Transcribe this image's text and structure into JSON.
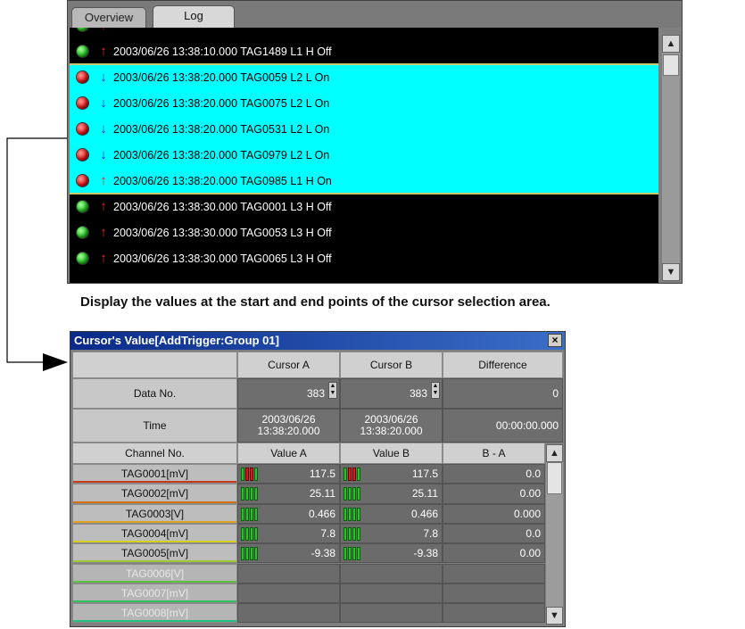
{
  "log_window": {
    "tabs": [
      {
        "label": "Overview",
        "active": false
      },
      {
        "label": "Log",
        "active": true
      }
    ],
    "rows": [
      {
        "status": "green",
        "direction": "up",
        "text": "2003/06/26 13:38:10.000 TAG1489 L1 H  Off",
        "highlighted": false
      },
      {
        "status": "red",
        "direction": "down",
        "text": "2003/06/26 13:38:20.000 TAG0059 L2 L  On",
        "highlighted": true
      },
      {
        "status": "red",
        "direction": "down",
        "text": "2003/06/26 13:38:20.000 TAG0075 L2 L  On",
        "highlighted": true
      },
      {
        "status": "red",
        "direction": "down",
        "text": "2003/06/26 13:38:20.000 TAG0531 L2 L  On",
        "highlighted": true
      },
      {
        "status": "red",
        "direction": "down",
        "text": "2003/06/26 13:38:20.000 TAG0979 L2 L  On",
        "highlighted": true
      },
      {
        "status": "red",
        "direction": "up",
        "text": "2003/06/26 13:38:20.000 TAG0985 L1 H  On",
        "highlighted": true
      },
      {
        "status": "green",
        "direction": "up",
        "text": "2003/06/26 13:38:30.000 TAG0001 L3 H  Off",
        "highlighted": false
      },
      {
        "status": "green",
        "direction": "up",
        "text": "2003/06/26 13:38:30.000 TAG0053 L3 H  Off",
        "highlighted": false
      },
      {
        "status": "green",
        "direction": "up",
        "text": "2003/06/26 13:38:30.000 TAG0065 L3 H  Off",
        "highlighted": false
      }
    ]
  },
  "caption": "Display the values at the start and end points of the cursor selection area.",
  "cursor_window": {
    "title": "Cursor's Value[AddTrigger:Group 01]",
    "close_label": "×",
    "headers": {
      "cursor_a": "Cursor A",
      "cursor_b": "Cursor B",
      "difference": "Difference"
    },
    "data_no": {
      "label": "Data No.",
      "a": "383",
      "b": "383",
      "diff": "0"
    },
    "time": {
      "label": "Time",
      "a_line1": "2003/06/26",
      "a_line2": "13:38:20.000",
      "b_line1": "2003/06/26",
      "b_line2": "13:38:20.000",
      "diff": "00:00:00.000"
    },
    "channel_header": {
      "channel": "Channel No.",
      "value_a": "Value A",
      "value_b": "Value B",
      "b_minus_a": "B - A"
    },
    "channels": [
      {
        "name": "TAG0001[mV]",
        "a": "117.5",
        "b": "117.5",
        "diff": "0.0",
        "color": "#c83a1e",
        "enabled": true,
        "alarm": true
      },
      {
        "name": "TAG0002[mV]",
        "a": "25.11",
        "b": "25.11",
        "diff": "0.00",
        "color": "#d07010",
        "enabled": true,
        "alarm": false
      },
      {
        "name": "TAG0003[V]",
        "a": "0.466",
        "b": "0.466",
        "diff": "0.000",
        "color": "#e0a020",
        "enabled": true,
        "alarm": false
      },
      {
        "name": "TAG0004[mV]",
        "a": "7.8",
        "b": "7.8",
        "diff": "0.0",
        "color": "#d8d020",
        "enabled": true,
        "alarm": false
      },
      {
        "name": "TAG0005[mV]",
        "a": "-9.38",
        "b": "-9.38",
        "diff": "0.00",
        "color": "#a0c830",
        "enabled": true,
        "alarm": false
      },
      {
        "name": "TAG0006[V]",
        "a": "",
        "b": "",
        "diff": "",
        "color": "#60c040",
        "enabled": false,
        "alarm": false
      },
      {
        "name": "TAG0007[mV]",
        "a": "",
        "b": "",
        "diff": "",
        "color": "#30c060",
        "enabled": false,
        "alarm": false
      },
      {
        "name": "TAG0008[mV]",
        "a": "",
        "b": "",
        "diff": "",
        "color": "#20c080",
        "enabled": false,
        "alarm": false
      }
    ]
  }
}
